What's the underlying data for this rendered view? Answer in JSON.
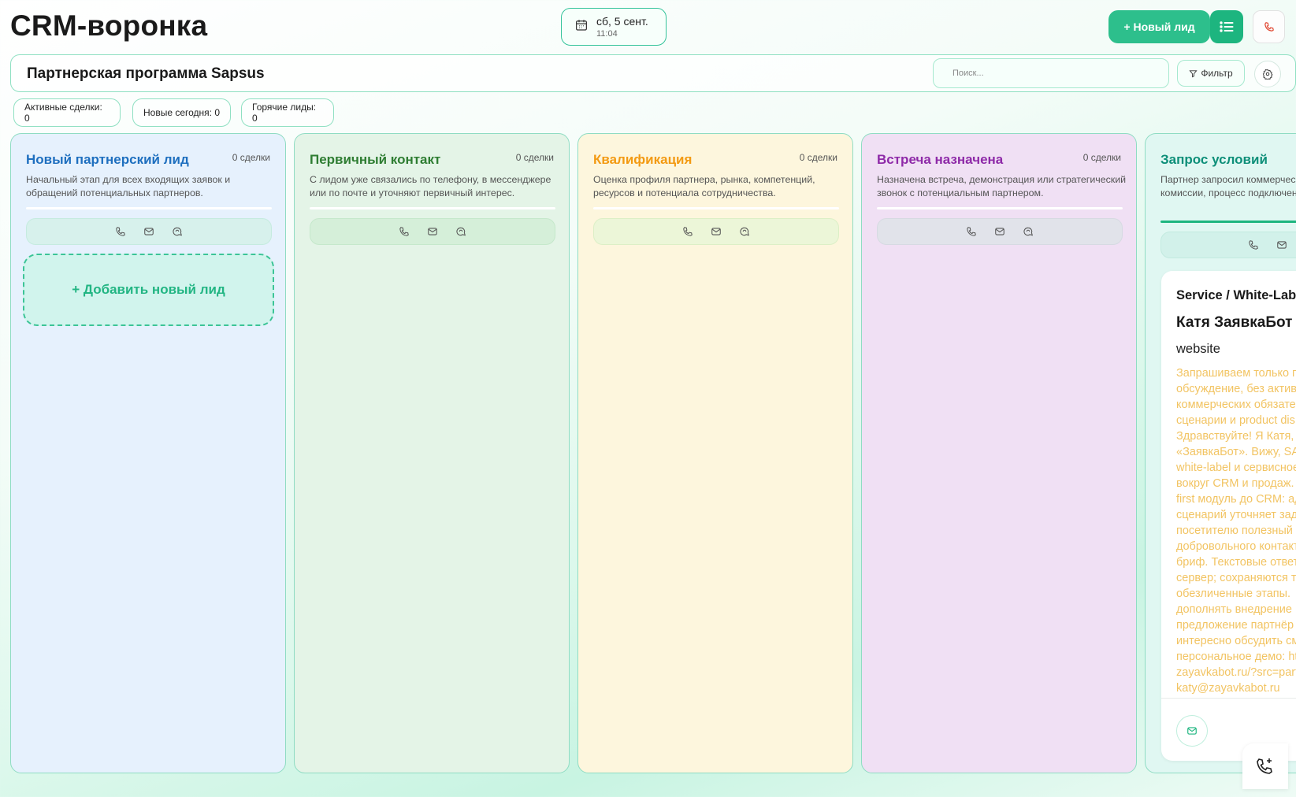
{
  "header": {
    "title": "CRM-воронка",
    "date": "сб, 5 сент.",
    "time": "11:04",
    "new_lead_label": "+ Новый лид"
  },
  "pipeline": {
    "name": "Партнерская программа Sapsus",
    "search_placeholder": "Поиск...",
    "filter_label": "Фильтр"
  },
  "stats": [
    {
      "label": "Активные сделки: 0"
    },
    {
      "label": "Новые сегодня: 0"
    },
    {
      "label": "Горячие лиды: 0"
    }
  ],
  "columns": [
    {
      "title": "Новый партнерский лид",
      "count": "0 сделки",
      "description": "Начальный этап для всех входящих заявок и обращений потенциальных партнеров.",
      "title_color": "#1e6fbf",
      "add_label": "+ Добавить новый лид"
    },
    {
      "title": "Первичный контакт",
      "count": "0 сделки",
      "description": "С лидом уже связались по телефону, в мессенджере или по почте и уточняют первичный интерес.",
      "title_color": "#2e7d32"
    },
    {
      "title": "Квалификация",
      "count": "0 сделки",
      "description": "Оценка профиля партнера, рынка, компетенций, ресурсов и потенциала сотрудничества.",
      "title_color": "#f39a12"
    },
    {
      "title": "Встреча назначена",
      "count": "0 сделки",
      "description": "Назначена встреча, демонстрация или стратегический звонок с потенциальным партнером.",
      "title_color": "#8e2aa8"
    },
    {
      "title": "Запрос условий",
      "count": "",
      "description": "Партнер запросил коммерческие условия, размер комиссии, процесс подключения и формат поддержки.",
      "title_color": "#0e8f79"
    }
  ],
  "lead_card": {
    "source": "Service / White-Label",
    "name": "Катя ЗаявкаБот (",
    "channel": "website",
    "message": "Запрашиваем только п\nобсуждение, без актив\nкоммерческих обязате\nсценарии и product dis\nЗдравствуйте! Я Катя,\n«ЗаявкаБот». Вижу, SAB\nwhite-label и сервисное\nвокруг CRM и продаж. \nfirst модуль до CRM: ад\nсценарий уточняет зад\nпосетителю полезный \nдобровольного контакт\nбриф. Текстовые ответ\nсервер; сохраняются т\nобезличенные этапы. \nдополнять внедрение \nпредложение партнёр\nинтересно обсудить см\nперсональное демо: ht\nzayavkabot.ru/?src=part\nkaty@zayavkabot.ru"
  },
  "colors": {
    "accent": "#2dbf8c",
    "accent_dark": "#1db57f",
    "lead_text": "#f2c463"
  },
  "icons": [
    "calendar-icon",
    "list-icon",
    "phone-icon",
    "mail-icon",
    "chat-icon",
    "filter-icon",
    "settings-icon",
    "phone-plus-icon"
  ]
}
